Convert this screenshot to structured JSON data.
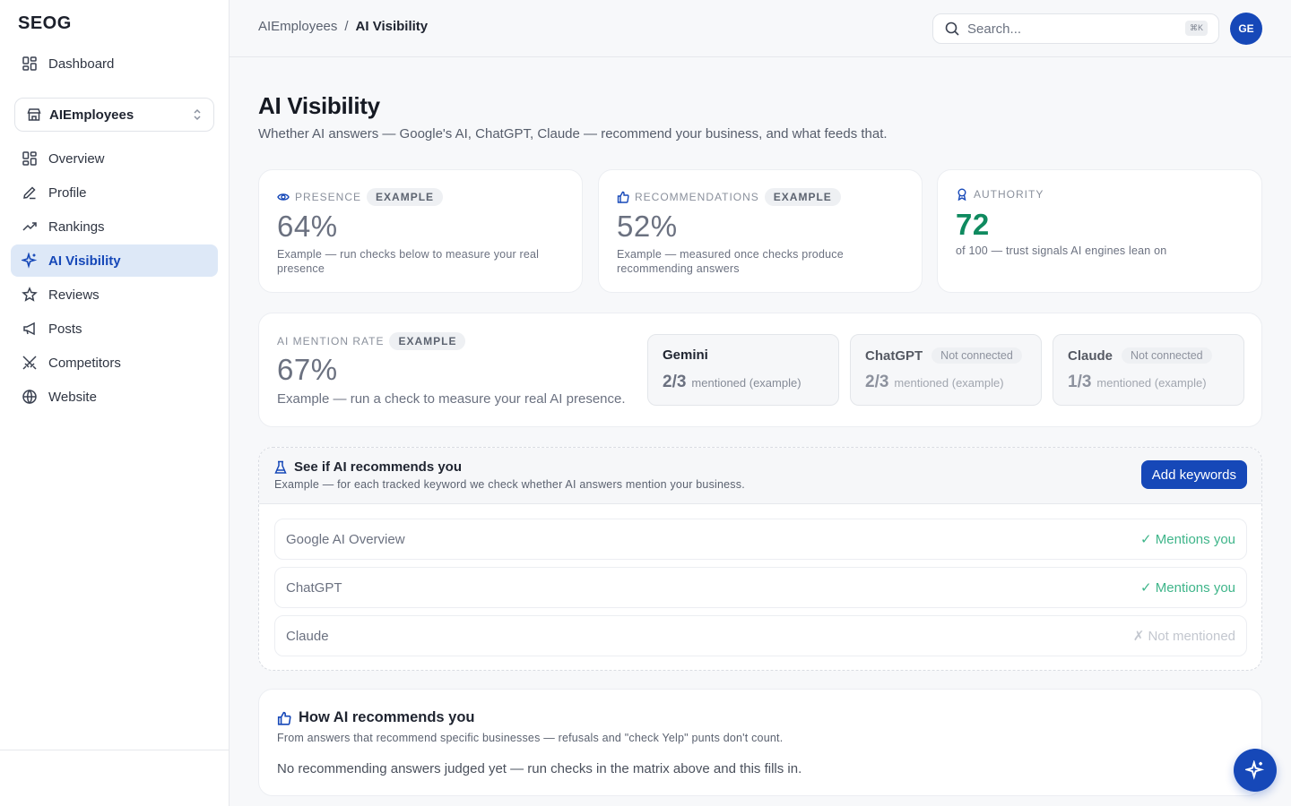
{
  "brand": {
    "logo_text": "SEOG"
  },
  "sidebar": {
    "dashboard_label": "Dashboard",
    "workspace": "AIEmployees",
    "items": [
      {
        "label": "Overview",
        "icon": "grid-icon"
      },
      {
        "label": "Profile",
        "icon": "pen-icon"
      },
      {
        "label": "Rankings",
        "icon": "trend-icon"
      },
      {
        "label": "AI Visibility",
        "icon": "sparkle-icon",
        "active": true
      },
      {
        "label": "Reviews",
        "icon": "star-icon"
      },
      {
        "label": "Posts",
        "icon": "megaphone-icon"
      },
      {
        "label": "Competitors",
        "icon": "swords-icon"
      },
      {
        "label": "Website",
        "icon": "globe-icon"
      }
    ]
  },
  "header": {
    "breadcrumb": [
      "AIEmployees",
      "/",
      "AI Visibility"
    ],
    "search_placeholder": "Search...",
    "search_shortcut": "⌘K",
    "avatar_initials": "GE"
  },
  "page": {
    "title": "AI Visibility",
    "subtitle": "Whether AI answers — Google's AI, ChatGPT, Claude — recommend your business, and what feeds that."
  },
  "stats": {
    "presence": {
      "label": "PRESENCE",
      "badge": "EXAMPLE",
      "value": "64%",
      "note": "Example — run checks below to measure your real presence"
    },
    "recommendations": {
      "label": "RECOMMENDATIONS",
      "badge": "EXAMPLE",
      "value": "52%",
      "note": "Example — measured once checks produce recommending answers"
    },
    "authority": {
      "label": "AUTHORITY",
      "value": "72",
      "note": "of 100 — trust signals AI engines lean on"
    }
  },
  "mention_rate": {
    "label": "AI MENTION RATE",
    "badge": "EXAMPLE",
    "value": "67%",
    "note": "Example — run a check to measure your real AI presence.",
    "engines": [
      {
        "name": "Gemini",
        "status": "",
        "score": "2/3",
        "suffix": "mentioned (example)"
      },
      {
        "name": "ChatGPT",
        "status": "Not connected",
        "score": "2/3",
        "suffix": "mentioned (example)"
      },
      {
        "name": "Claude",
        "status": "Not connected",
        "score": "1/3",
        "suffix": "mentioned (example)"
      }
    ]
  },
  "matrix": {
    "title": "See if AI recommends you",
    "subtitle": "Example — for each tracked keyword we check whether AI answers mention your business.",
    "button": "Add keywords",
    "rows": [
      {
        "engine": "Google AI Overview",
        "result": "✓ Mentions you"
      },
      {
        "engine": "ChatGPT",
        "result": "✓ Mentions you"
      },
      {
        "engine": "Claude",
        "result": "✗ Not mentioned"
      }
    ]
  },
  "how": {
    "title": "How AI recommends you",
    "subtitle": "From answers that recommend specific businesses — refusals and \"check Yelp\" punts don't count.",
    "empty": "No recommending answers judged yet — run checks in the matrix above and this fills in."
  },
  "colors": {
    "accent": "#1648b8",
    "positive": "#0f8a5f",
    "mention": "#3fb58a",
    "active_bg": "#dde8f7"
  }
}
